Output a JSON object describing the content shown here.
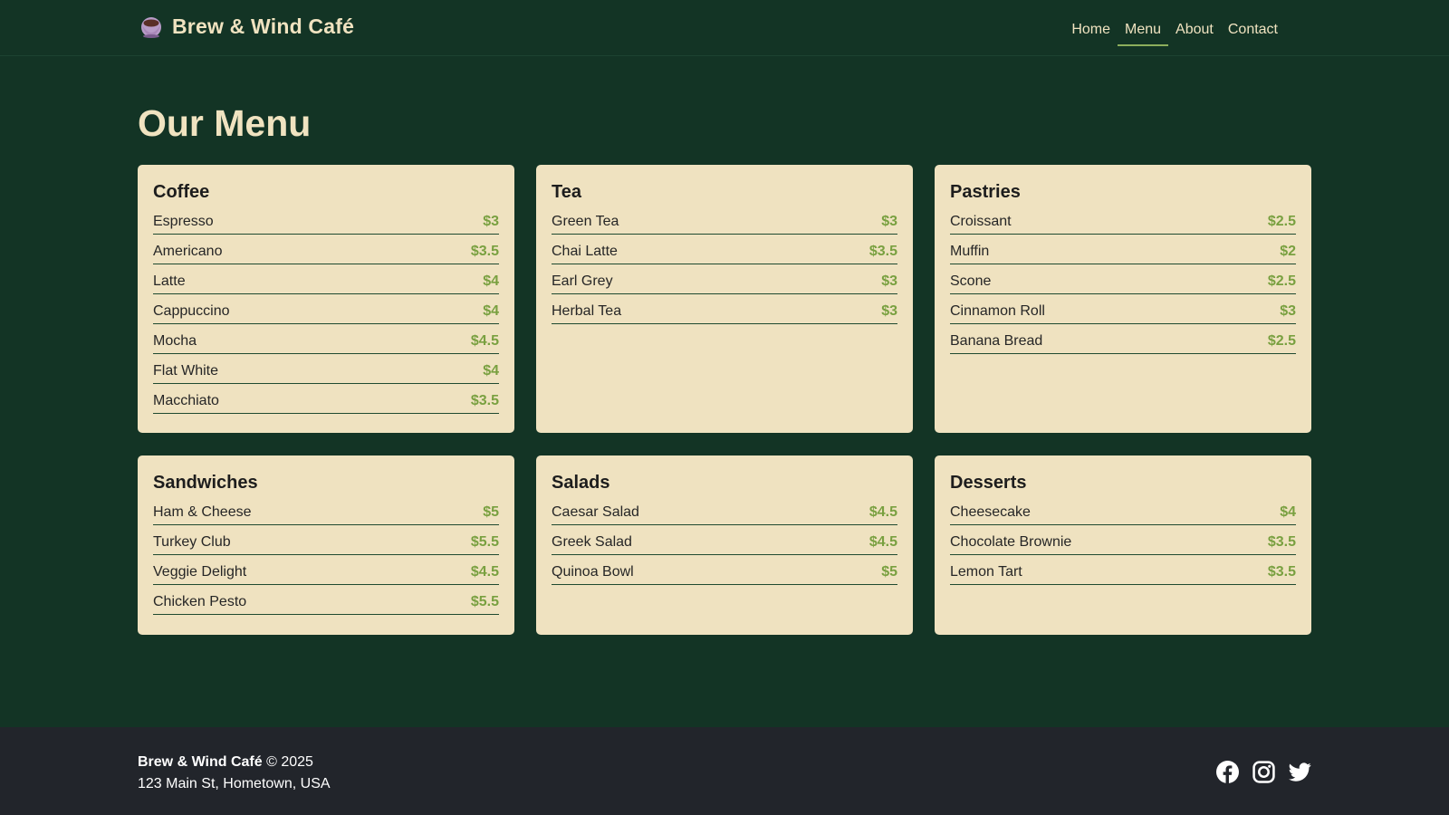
{
  "header": {
    "brand_name": "Brew & Wind Café",
    "nav": [
      {
        "label": "Home",
        "active": false
      },
      {
        "label": "Menu",
        "active": true
      },
      {
        "label": "About",
        "active": false
      },
      {
        "label": "Contact",
        "active": false
      }
    ]
  },
  "main": {
    "title": "Our Menu",
    "categories": [
      {
        "title": "Coffee",
        "items": [
          {
            "name": "Espresso",
            "price": "$3"
          },
          {
            "name": "Americano",
            "price": "$3.5"
          },
          {
            "name": "Latte",
            "price": "$4"
          },
          {
            "name": "Cappuccino",
            "price": "$4"
          },
          {
            "name": "Mocha",
            "price": "$4.5"
          },
          {
            "name": "Flat White",
            "price": "$4"
          },
          {
            "name": "Macchiato",
            "price": "$3.5"
          }
        ]
      },
      {
        "title": "Tea",
        "items": [
          {
            "name": "Green Tea",
            "price": "$3"
          },
          {
            "name": "Chai Latte",
            "price": "$3.5"
          },
          {
            "name": "Earl Grey",
            "price": "$3"
          },
          {
            "name": "Herbal Tea",
            "price": "$3"
          }
        ]
      },
      {
        "title": "Pastries",
        "items": [
          {
            "name": "Croissant",
            "price": "$2.5"
          },
          {
            "name": "Muffin",
            "price": "$2"
          },
          {
            "name": "Scone",
            "price": "$2.5"
          },
          {
            "name": "Cinnamon Roll",
            "price": "$3"
          },
          {
            "name": "Banana Bread",
            "price": "$2.5"
          }
        ]
      },
      {
        "title": "Sandwiches",
        "items": [
          {
            "name": "Ham & Cheese",
            "price": "$5"
          },
          {
            "name": "Turkey Club",
            "price": "$5.5"
          },
          {
            "name": "Veggie Delight",
            "price": "$4.5"
          },
          {
            "name": "Chicken Pesto",
            "price": "$5.5"
          }
        ]
      },
      {
        "title": "Salads",
        "items": [
          {
            "name": "Caesar Salad",
            "price": "$4.5"
          },
          {
            "name": "Greek Salad",
            "price": "$4.5"
          },
          {
            "name": "Quinoa Bowl",
            "price": "$5"
          }
        ]
      },
      {
        "title": "Desserts",
        "items": [
          {
            "name": "Cheesecake",
            "price": "$4"
          },
          {
            "name": "Chocolate Brownie",
            "price": "$3.5"
          },
          {
            "name": "Lemon Tart",
            "price": "$3.5"
          }
        ]
      }
    ]
  },
  "footer": {
    "brand": "Brew & Wind Café",
    "copyright": " © 2025",
    "address": "123 Main St, Hometown, USA",
    "socials": [
      "facebook-icon",
      "instagram-icon",
      "twitter-icon"
    ]
  },
  "colors": {
    "background": "#133425",
    "card": "#efe2c0",
    "text_light": "#f0e3c0",
    "price": "#79a040",
    "footer": "#22252b"
  }
}
